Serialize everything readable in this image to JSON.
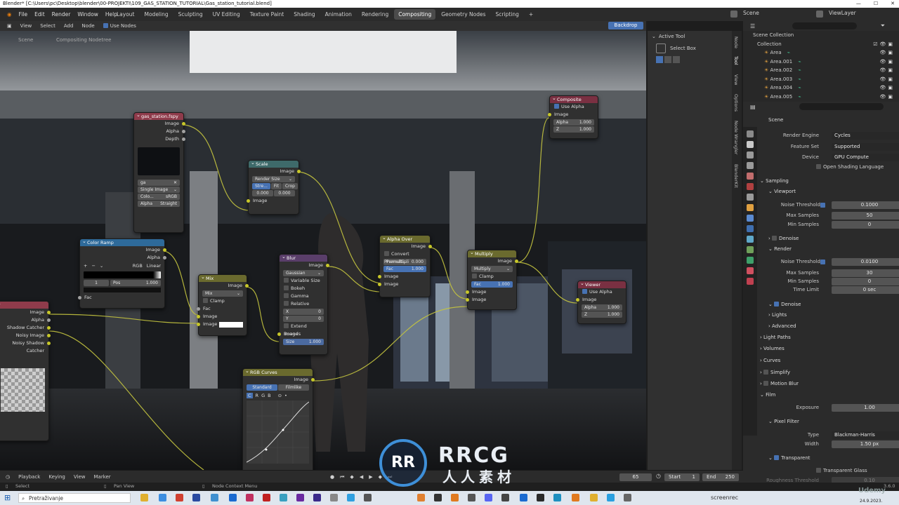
{
  "window": {
    "title": "Blender* [C:\\Users\\pc\\Desktop\\blender\\00-PROJEKTI\\109_GAS_STATION_TUTORIAL\\Gas_station_tutorial.blend]"
  },
  "menu": [
    "File",
    "Edit",
    "Render",
    "Window",
    "Help"
  ],
  "workspaces": [
    "Layout",
    "Modeling",
    "Sculpting",
    "UV Editing",
    "Texture Paint",
    "Shading",
    "Animation",
    "Rendering",
    "Compositing",
    "Geometry Nodes",
    "Scripting"
  ],
  "active_workspace": "Compositing",
  "top_right": {
    "scene": "Scene",
    "view_layer": "ViewLayer"
  },
  "node_header": {
    "items": [
      "View",
      "Select",
      "Add",
      "Node"
    ],
    "use_nodes": "Use Nodes",
    "backdrop": "Backdrop"
  },
  "breadcrumb": {
    "scene": "Scene",
    "tree": "Compositing Nodetree"
  },
  "nodes": {
    "image": {
      "title": "gas_station.fspy",
      "outputs": [
        "Image",
        "Alpha",
        "Depth"
      ],
      "name_field": "ga",
      "source": "Single Image",
      "color_label": "Colo...",
      "color_value": "sRGB",
      "alpha_label": "Alpha",
      "alpha_value": "Straight"
    },
    "scale": {
      "title": "Scale",
      "output": "Image",
      "mode": "Render Size",
      "buttons": [
        "Stre...",
        "Fit",
        "Crop"
      ],
      "x": "0.000",
      "y": "0.000",
      "input": "Image"
    },
    "color_ramp": {
      "title": "Color Ramp",
      "outputs": [
        "Image",
        "Alpha"
      ],
      "mode": "RGB",
      "interp": "Linear",
      "index": "1",
      "pos_label": "Pos",
      "pos_value": "1.000",
      "input": "Fac"
    },
    "mix": {
      "title": "Mix",
      "output": "Image",
      "mode": "Mix",
      "clamp": "Clamp",
      "inputs": [
        "Fac",
        "Image",
        "Image"
      ]
    },
    "blur": {
      "title": "Blur",
      "output": "Image",
      "type": "Gaussian",
      "options": [
        "Variable Size",
        "Bokeh",
        "Gamma",
        "Relative"
      ],
      "x_label": "X",
      "x_value": "0",
      "y_label": "Y",
      "y_value": "0",
      "extend": "Extend Bounds",
      "input": "Image",
      "size_label": "Size",
      "size_value": "1.000"
    },
    "alpha_over": {
      "title": "Alpha Over",
      "output": "Image",
      "convert": "Convert Premulti...",
      "premul_label": "Premultipli",
      "premul_value": "0.000",
      "fac_label": "Fac",
      "fac_value": "1.000",
      "inputs": [
        "Image",
        "Image"
      ]
    },
    "multiply": {
      "title": "Multiply",
      "output": "Image",
      "mode": "Multiply",
      "clamp": "Clamp",
      "fac_label": "Fac",
      "fac_value": "1.000",
      "inputs": [
        "Image",
        "Image"
      ]
    },
    "composite": {
      "title": "Composite",
      "use_alpha": "Use Alpha",
      "input": "Image",
      "alpha_label": "Alpha",
      "alpha_value": "1.000",
      "z_label": "Z",
      "z_value": "1.000"
    },
    "viewer": {
      "title": "Viewer",
      "use_alpha": "Use Alpha",
      "input": "Image",
      "alpha_label": "Alpha",
      "alpha_value": "1.000",
      "z_label": "Z",
      "z_value": "1.000"
    },
    "rgb_curves": {
      "title": "RGB Curves",
      "output": "Image",
      "tabs": [
        "Standard",
        "Filmlike"
      ],
      "channels": [
        "C",
        "R",
        "G",
        "B"
      ]
    },
    "render_layers": {
      "outputs": [
        "Image",
        "Alpha",
        "Shadow Catcher",
        "Noisy Image",
        "Noisy Shadow Catcher"
      ]
    }
  },
  "tool_panel": {
    "title": "Active Tool",
    "tool": "Select Box"
  },
  "side_tabs": [
    "Node",
    "Tool",
    "View",
    "Options",
    "Node Wrangler",
    "BlenderKit"
  ],
  "outliner": {
    "root": "Scene Collection",
    "collection": "Collection",
    "items": [
      "Area",
      "Area.001",
      "Area.002",
      "Area.003",
      "Area.004",
      "Area.005"
    ]
  },
  "properties": {
    "scene": "Scene",
    "render_engine": {
      "label": "Render Engine",
      "value": "Cycles"
    },
    "feature_set": {
      "label": "Feature Set",
      "value": "Supported"
    },
    "device": {
      "label": "Device",
      "value": "GPU Compute"
    },
    "osl": "Open Shading Language",
    "sampling": "Sampling",
    "viewport": "Viewport",
    "vp_noise": {
      "label": "Noise Threshold",
      "value": "0.1000"
    },
    "vp_max": {
      "label": "Max Samples",
      "value": "50"
    },
    "vp_min": {
      "label": "Min Samples",
      "value": "0"
    },
    "denoise1": "Denoise",
    "render": "Render",
    "r_noise": {
      "label": "Noise Threshold",
      "value": "0.0100"
    },
    "r_max": {
      "label": "Max Samples",
      "value": "30"
    },
    "r_min": {
      "label": "Min Samples",
      "value": "0"
    },
    "r_time": {
      "label": "Time Limit",
      "value": "0 sec"
    },
    "denoise2": "Denoise",
    "lights": "Lights",
    "advanced": "Advanced",
    "light_paths": "Light Paths",
    "volumes": "Volumes",
    "curves": "Curves",
    "simplify": "Simplify",
    "motion_blur": "Motion Blur",
    "film": "Film",
    "exposure": {
      "label": "Exposure",
      "value": "1.00"
    },
    "pixel_filter": "Pixel Filter",
    "type": {
      "label": "Type",
      "value": "Blackman-Harris"
    },
    "width": {
      "label": "Width",
      "value": "1.50 px"
    },
    "transparent": "Transparent",
    "transparent_glass": "Transparent Glass",
    "roughness": {
      "label": "Roughness Threshold",
      "value": "0.10"
    }
  },
  "timeline": {
    "menu": [
      "Playback",
      "Keying",
      "View",
      "Marker"
    ],
    "frame": "65",
    "start_label": "Start",
    "start": "1",
    "end_label": "End",
    "end": "250"
  },
  "statusbar": {
    "select": "Select",
    "pan": "Pan View",
    "context": "Node Context Menu",
    "version": "3.6.0"
  },
  "taskbar": {
    "search": "Pretraživanje",
    "date": "24.9.2023."
  },
  "watermark": {
    "logo": "RRCG",
    "sub": "人人素材",
    "udemy": "Udemy",
    "screenrec": "screenrec"
  }
}
